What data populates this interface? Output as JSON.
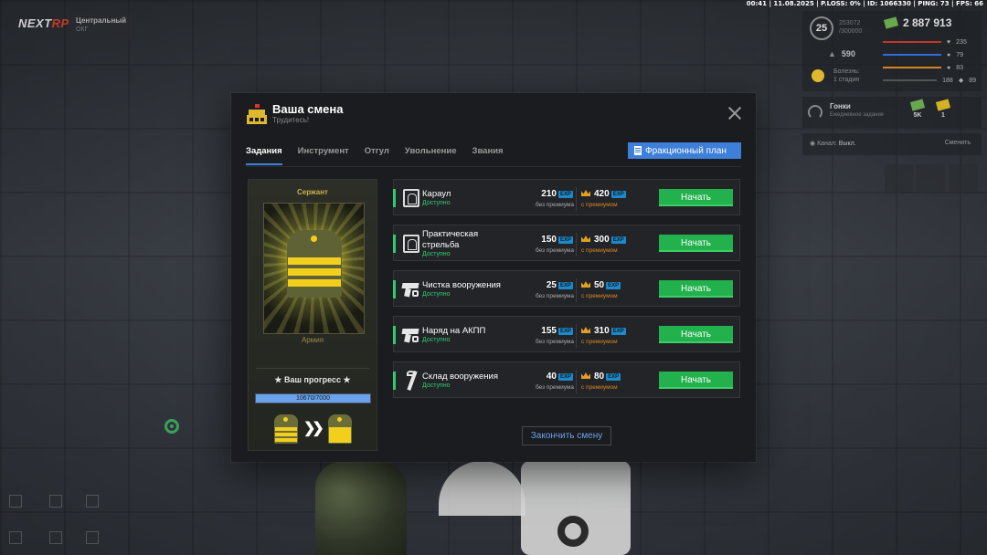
{
  "topbar": {
    "info": "00:41 | 11.08.2025 | P.LOSS: 0% | ID: 1066330 | PING: 73 | FPS: 66"
  },
  "logo": {
    "left": "NEXT",
    "right": "RP"
  },
  "location": {
    "name": "Центральный",
    "sub": "ОКГ"
  },
  "hud": {
    "level": "25",
    "xp_line1": "253072",
    "xp_line2": "/300000",
    "money": "2 887 913",
    "cash": "590",
    "status_line1": "Болезнь:",
    "status_line2": "1 стадия",
    "stats": [
      {
        "value": "235",
        "color": "#c0392b"
      },
      {
        "value": "79",
        "color": "#2e6fd8"
      },
      {
        "value": "83",
        "color": "#d6821e"
      },
      {
        "value": "89",
        "color": "#555555"
      }
    ],
    "extra_stat": "188"
  },
  "race": {
    "title": "Гонки",
    "subtitle": "Ежедневное задание",
    "reward1": "5K",
    "reward2": "1"
  },
  "channel": {
    "label": "Канал:",
    "value": "Выкл.",
    "action": "Сменить"
  },
  "modal": {
    "title": "Ваша смена",
    "subtitle": "Трудитесь!",
    "tabs": [
      "Задания",
      "Инструмент",
      "Отгул",
      "Увольнение",
      "Звания"
    ],
    "active_tab": 0,
    "faction_button": "Фракционный план",
    "finish_button": "Закончить смену"
  },
  "rank": {
    "name": "Сержант",
    "branch": "Армия",
    "progress_title": "★ Ваш прогресс ★",
    "progress_text": "10670/7000",
    "progress_fraction": 1.0
  },
  "tasks": [
    {
      "name_lines": [
        "Караул"
      ],
      "status": "Доступно",
      "base": "210",
      "premium": "420",
      "icon": "target-icon"
    },
    {
      "name_lines": [
        "Практическая",
        "стрельба"
      ],
      "status": "Доступно",
      "base": "150",
      "premium": "300",
      "icon": "target-icon"
    },
    {
      "name_lines": [
        "Чистка вооружения"
      ],
      "status": "Доступно",
      "base": "25",
      "premium": "50",
      "icon": "gun-icon"
    },
    {
      "name_lines": [
        "Наряд на АКПП"
      ],
      "status": "Доступно",
      "base": "155",
      "premium": "310",
      "icon": "gun-icon"
    },
    {
      "name_lines": [
        "Склад вооружения"
      ],
      "status": "Доступно",
      "base": "40",
      "premium": "80",
      "icon": "tools-icon"
    }
  ],
  "labels": {
    "exp": "EXP",
    "no_premium": "без премиума",
    "with_premium": "с премиумом",
    "start": "Начать"
  }
}
